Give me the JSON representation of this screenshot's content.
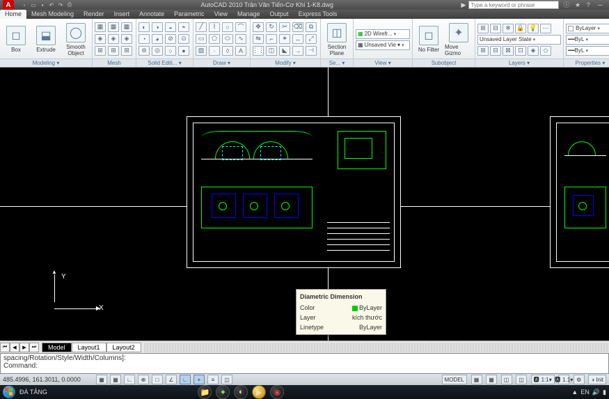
{
  "title": {
    "app": "AutoCAD 2010",
    "file": "Trần Văn Tiến-Cơ Khí 1-K8.dwg",
    "full": "AutoCAD 2010    Trần Văn Tiến-Cơ Khí 1-K8.dwg"
  },
  "search": {
    "placeholder": "Type a keyword or phrase"
  },
  "menu": {
    "items": [
      "Home",
      "Mesh Modeling",
      "Render",
      "Insert",
      "Annotate",
      "Parametric",
      "View",
      "Manage",
      "Output",
      "Express Tools"
    ],
    "active": 0
  },
  "ribbon": {
    "modeling": {
      "title": "Modeling ▾",
      "box": "Box",
      "extrude": "Extrude",
      "smooth": "Smooth\nObject"
    },
    "mesh": {
      "title": "Mesh"
    },
    "solid": {
      "title": "Solid Editi... ▾"
    },
    "draw": {
      "title": "Draw ▾"
    },
    "modify": {
      "title": "Modify ▾"
    },
    "section": {
      "title": "Se... ▾",
      "label": "Section\nPlane"
    },
    "view": {
      "title": "View ▾",
      "wireframe": "2D Wirefr...",
      "unsaved": "Unsaved Vie ▾"
    },
    "subobject": {
      "title": "Subobject",
      "nofilter": "No Filter",
      "gizmo": "Move Gizmo"
    },
    "layers": {
      "title": "Layers ▾",
      "state": "Unsaved Layer State"
    },
    "properties": {
      "title": "Properties ▾",
      "bylayer1": "ByLayer",
      "bylayer2": "ByL",
      "bylayer3": "ByL"
    }
  },
  "ucs": {
    "x": "X",
    "y": "Y"
  },
  "tooltip": {
    "title": "Diametric Dimension",
    "color_label": "Color",
    "color_value": "ByLayer",
    "layer_label": "Layer",
    "layer_value": "kích thước",
    "linetype_label": "Linetype",
    "linetype_value": "ByLayer"
  },
  "layout_tabs": {
    "tabs": [
      "Model",
      "Layout1",
      "Layout2"
    ],
    "active": 0
  },
  "command": {
    "line1": "spacing/Rotation/Style/Width/Columns]:",
    "line2": "Command:"
  },
  "status": {
    "coords": "485.4996, 161.3011, 0.0000",
    "model": "MODEL",
    "scale": "1:1",
    "angle": "1.1"
  },
  "taskbar": {
    "text": "ĐÁ TẢNG",
    "lang": "EN",
    "time": ""
  }
}
